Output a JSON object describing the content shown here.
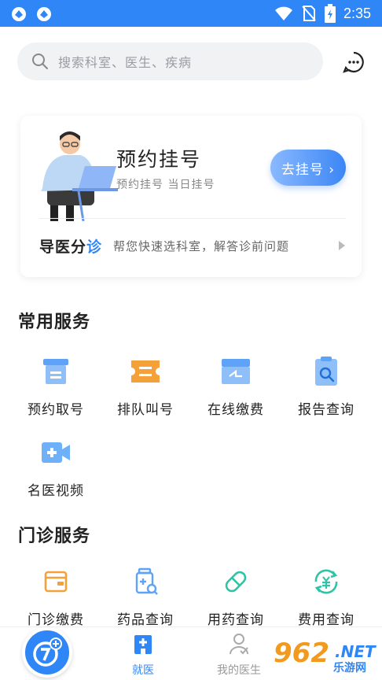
{
  "status_bar": {
    "time": "2:35"
  },
  "search": {
    "placeholder": "搜索科室、医生、疾病"
  },
  "booking_card": {
    "title": "预约挂号",
    "subtitle": "预约挂号  当日挂号",
    "button_label": "去挂号 ›",
    "guide_logo_a": "导医分",
    "guide_logo_b": "诊",
    "guide_desc": "帮您快速选科室，解答诊前问题"
  },
  "common_services": {
    "title": "常用服务",
    "items": [
      {
        "label": "预约取号",
        "icon": "ticket-box-icon"
      },
      {
        "label": "排队叫号",
        "icon": "queue-ticket-icon"
      },
      {
        "label": "在线缴费",
        "icon": "payment-card-icon"
      },
      {
        "label": "报告查询",
        "icon": "report-search-icon"
      },
      {
        "label": "名医视频",
        "icon": "video-consult-icon"
      }
    ]
  },
  "outpatient_services": {
    "title": "门诊服务",
    "items": [
      {
        "label": "门诊缴费",
        "icon": "wallet-icon"
      },
      {
        "label": "药品查询",
        "icon": "medicine-search-icon"
      },
      {
        "label": "用药查询",
        "icon": "pill-icon"
      },
      {
        "label": "费用查询",
        "icon": "yuan-cycle-icon"
      }
    ]
  },
  "tabbar": {
    "tabs": [
      {
        "label": "就医",
        "active": true
      },
      {
        "label": "我的医生",
        "active": false
      }
    ]
  },
  "watermark": {
    "number": "962",
    "suffix": ".NET",
    "site": "乐游网"
  },
  "colors": {
    "accent": "#2f86f6",
    "orange": "#f5a13a",
    "teal": "#2ec4a6"
  }
}
